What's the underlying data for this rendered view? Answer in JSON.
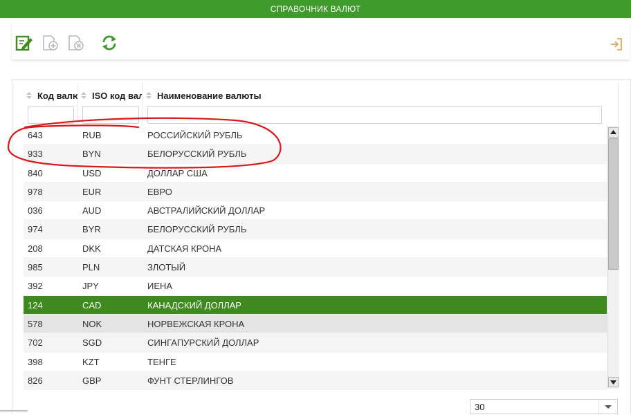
{
  "window": {
    "title": "СПРАВОЧНИК ВАЛЮТ"
  },
  "colors": {
    "accent": "#3f9a2c",
    "selected_row": "#3f8a1e",
    "annotation": "#d81818"
  },
  "toolbar": {
    "buttons": [
      "edit-icon",
      "add-icon",
      "delete-icon",
      "refresh-icon"
    ],
    "exit": "exit-icon"
  },
  "table": {
    "columns": [
      "Код валюты",
      "ISO код валюты",
      "Наименование валюты"
    ],
    "filters": [
      "",
      "",
      ""
    ],
    "rows": [
      {
        "code": "643",
        "iso": "RUB",
        "name": "РОССИЙСКИЙ РУБЛЬ"
      },
      {
        "code": "933",
        "iso": "BYN",
        "name": "БЕЛОРУССКИЙ РУБЛЬ"
      },
      {
        "code": "840",
        "iso": "USD",
        "name": "ДОЛЛАР США"
      },
      {
        "code": "978",
        "iso": "EUR",
        "name": "ЕВРО"
      },
      {
        "code": "036",
        "iso": "AUD",
        "name": "АВСТРАЛИЙСКИЙ ДОЛЛАР"
      },
      {
        "code": "974",
        "iso": "BYR",
        "name": "БЕЛОРУССКИЙ РУБЛЬ"
      },
      {
        "code": "208",
        "iso": "DKK",
        "name": "ДАТСКАЯ КРОНА"
      },
      {
        "code": "985",
        "iso": "PLN",
        "name": "ЗЛОТЫЙ"
      },
      {
        "code": "392",
        "iso": "JPY",
        "name": "ИЕНА"
      },
      {
        "code": "124",
        "iso": "CAD",
        "name": "КАНАДСКИЙ ДОЛЛАР",
        "selected": true
      },
      {
        "code": "578",
        "iso": "NOK",
        "name": "НОРВЕЖСКАЯ КРОНА",
        "hovered": true
      },
      {
        "code": "702",
        "iso": "SGD",
        "name": "СИНГАПУРСКИЙ ДОЛЛАР"
      },
      {
        "code": "398",
        "iso": "KZT",
        "name": "ТЕНГЕ"
      },
      {
        "code": "826",
        "iso": "GBP",
        "name": "ФУНТ СТЕРЛИНГОВ"
      }
    ]
  },
  "pager": {
    "page_size": "30"
  }
}
